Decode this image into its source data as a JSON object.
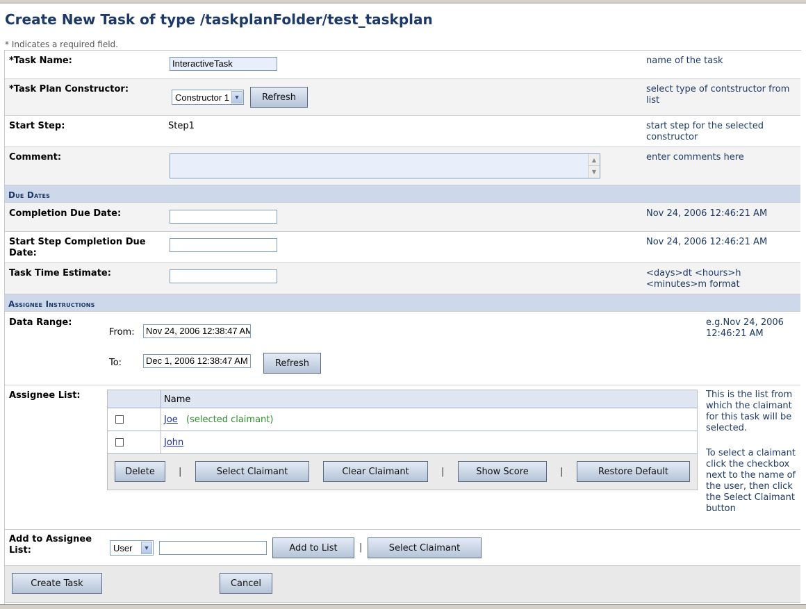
{
  "page": {
    "title": "Create New Task of type /taskplanFolder/test_taskplan",
    "required_note": "* Indicates a required field."
  },
  "task_name": {
    "label": "*Task Name:",
    "value": "InteractiveTask",
    "help": "name of the task"
  },
  "constructor": {
    "label": "*Task Plan Constructor:",
    "selected": "Constructor 1",
    "refresh_label": "Refresh",
    "help": "select type of contstructor from list"
  },
  "start_step": {
    "label": "Start Step:",
    "value": "Step1",
    "help": "start step for the selected constructor"
  },
  "comment": {
    "label": "Comment:",
    "value": "",
    "help": "enter comments here"
  },
  "due_dates": {
    "section_title": "Due Dates",
    "completion": {
      "label": "Completion Due Date:",
      "value": "",
      "help": "Nov 24, 2006 12:46:21 AM"
    },
    "start_step_completion": {
      "label": "Start Step Completion Due Date:",
      "value": "",
      "help": "Nov 24, 2006 12:46:21 AM"
    },
    "time_estimate": {
      "label": "Task Time Estimate:",
      "value": "",
      "help": "<days>dt <hours>h <minutes>m format"
    }
  },
  "assignee_instructions": {
    "section_title": "Assignee Instructions",
    "data_range": {
      "label": "Data Range:",
      "from_label": "From:",
      "from_value": "Nov 24, 2006 12:38:47 AM",
      "to_label": "To:",
      "to_value": "Dec 1, 2006 12:38:47 AM",
      "refresh_label": "Refresh",
      "help": "e.g.Nov 24, 2006 12:46:21 AM"
    },
    "assignee_list": {
      "label": "Assignee List:",
      "column_name": "Name",
      "rows": [
        {
          "name": "Joe",
          "note": "(selected claimant)"
        },
        {
          "name": "John",
          "note": ""
        }
      ],
      "buttons": {
        "delete": "Delete",
        "select_claimant": "Select Claimant",
        "clear_claimant": "Clear Claimant",
        "show_score": "Show Score",
        "restore_default": "Restore Default"
      },
      "separator": "|",
      "help1": "This is the list from which the claimant for this task will be selected.",
      "help2": "To select a claimant click the checkbox next to the name of the user, then click the Select Claimant button"
    },
    "add_to_list": {
      "label": "Add to Assignee List:",
      "type_selected": "User",
      "value": "",
      "add_label": "Add to List",
      "separator": "|",
      "select_claimant_label": "Select Claimant"
    }
  },
  "footer": {
    "create_label": "Create Task",
    "cancel_label": "Cancel"
  }
}
